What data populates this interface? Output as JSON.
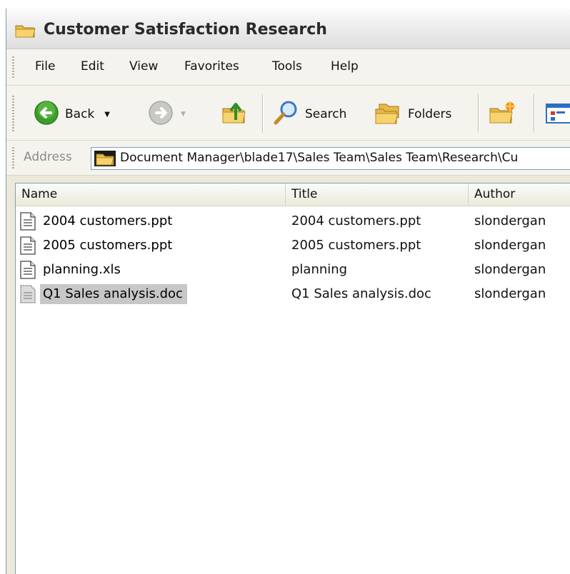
{
  "window": {
    "title": "Customer Satisfaction Research"
  },
  "menu": [
    "File",
    "Edit",
    "View",
    "Favorites",
    "Tools",
    "Help"
  ],
  "toolbar": {
    "back": "Back",
    "search": "Search",
    "folders": "Folders"
  },
  "address": {
    "label": "Address",
    "value": "Document Manager\\blade17\\Sales Team\\Sales Team\\Research\\Cu"
  },
  "columns": [
    "Name",
    "Title",
    "Author"
  ],
  "files": [
    {
      "name": "2004 customers.ppt",
      "title": "2004 customers.ppt",
      "author": "slondergan",
      "selected": false
    },
    {
      "name": "2005 customers.ppt",
      "title": "2005 customers.ppt",
      "author": "slondergan",
      "selected": false
    },
    {
      "name": "planning.xls",
      "title": "planning",
      "author": "slondergan",
      "selected": false
    },
    {
      "name": "Q1 Sales analysis.doc",
      "title": "Q1 Sales analysis.doc",
      "author": "slondergan",
      "selected": true
    }
  ],
  "colors": {
    "address_border": "#7f9db9",
    "selection": "#c7c7c7",
    "back_green": "#3c9e2a"
  },
  "icons": [
    "folder-icon",
    "back-arrow-icon",
    "forward-arrow-icon",
    "folder-up-icon",
    "search-icon",
    "folders-icon",
    "new-folder-icon",
    "views-icon",
    "document-icon"
  ]
}
